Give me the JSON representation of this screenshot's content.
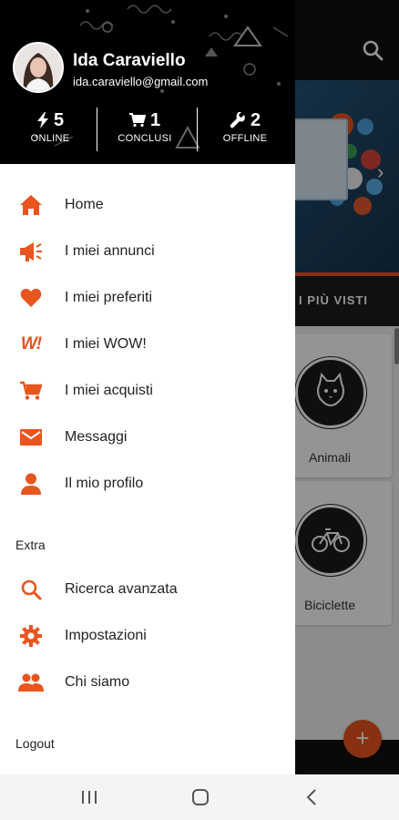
{
  "colors": {
    "accent": "#e8551f",
    "header_bg": "#000000",
    "drawer_bg": "#ffffff"
  },
  "user": {
    "name": "Ida Caraviello",
    "email": "ida.caraviello@gmail.com"
  },
  "stats": [
    {
      "icon": "bolt-icon",
      "value": "5",
      "label": "ONLINE"
    },
    {
      "icon": "cart-icon",
      "value": "1",
      "label": "CONCLUSI"
    },
    {
      "icon": "wrench-icon",
      "value": "2",
      "label": "OFFLINE"
    }
  ],
  "menu": [
    {
      "icon": "home-icon",
      "label": "Home"
    },
    {
      "icon": "megaphone-icon",
      "label": "I miei annunci"
    },
    {
      "icon": "heart-icon",
      "label": "I miei preferiti"
    },
    {
      "icon": "wow-icon",
      "icon_text": "W!",
      "label": "I miei WOW!"
    },
    {
      "icon": "cart-icon",
      "label": "I miei acquisti"
    },
    {
      "icon": "envelope-icon",
      "label": "Messaggi"
    },
    {
      "icon": "person-icon",
      "label": "Il mio profilo"
    }
  ],
  "extra_section": {
    "title": "Extra",
    "items": [
      {
        "icon": "search-icon",
        "label": "Ricerca avanzata"
      },
      {
        "icon": "gear-icon",
        "label": "Impostazioni"
      },
      {
        "icon": "people-icon",
        "label": "Chi siamo"
      }
    ]
  },
  "logout_label": "Logout",
  "background": {
    "tab_label": "I PIÙ VISTI",
    "categories": [
      {
        "icon": "cat-icon",
        "label": "Animali"
      },
      {
        "icon": "bicycle-icon",
        "label": "Biciclette"
      }
    ],
    "fab_label": "+"
  }
}
